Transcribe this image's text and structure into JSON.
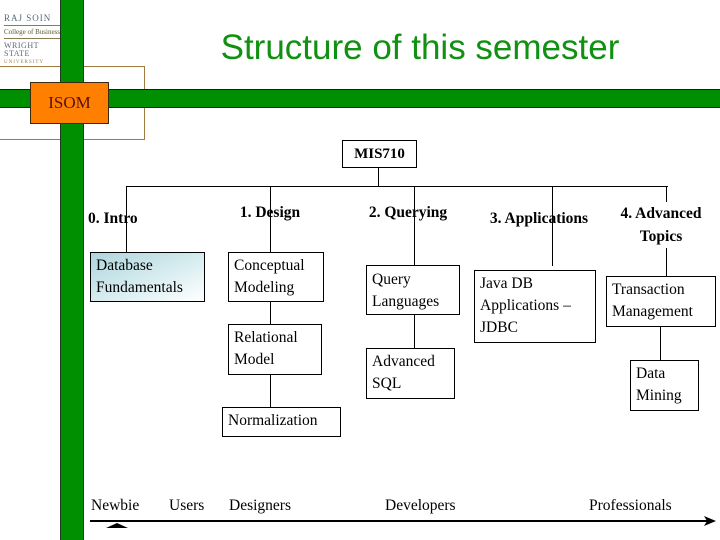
{
  "slide": {
    "title": "Structure of this semester",
    "badge": "ISOM",
    "logo": {
      "line1": "RAJ SOIN",
      "line2": "College of Business",
      "line3": "WRIGHT STATE",
      "line4": "UNIVERSITY"
    },
    "colors": {
      "title": "#119111",
      "green_bar": "#008f00",
      "badge_fill": "#ff7f00",
      "highlight_box": "#aed5dc"
    }
  },
  "tree": {
    "root": "MIS710",
    "categories": [
      {
        "label": "0. Intro",
        "children": [
          "Database Fundamentals"
        ]
      },
      {
        "label": "1. Design",
        "children": [
          "Conceptual Modeling",
          "Relational Model",
          "Normalization"
        ]
      },
      {
        "label": "2. Querying",
        "children": [
          "Query Languages",
          "Advanced SQL"
        ]
      },
      {
        "label": "3. Applications",
        "children": [
          "Java DB Applications – JDBC"
        ]
      },
      {
        "label": "4. Advanced Topics",
        "children": [
          "Transaction Management",
          "Data Mining"
        ]
      }
    ],
    "node_text": {
      "database_fundamentals": [
        "Database",
        "Fundamentals"
      ],
      "conceptual_modeling": [
        "Conceptual",
        "Modeling"
      ],
      "relational_model": [
        "Relational",
        "Model"
      ],
      "normalization": [
        "Normalization"
      ],
      "query_languages": [
        "Query",
        "Languages"
      ],
      "advanced_sql": [
        "Advanced",
        "SQL"
      ],
      "java_db": [
        "Java DB",
        "Applications –",
        "JDBC"
      ],
      "transaction_management": [
        "Transaction",
        "Management"
      ],
      "data_mining": [
        "Data",
        "Mining"
      ]
    },
    "category_text": {
      "intro": "0. Intro",
      "design": "1. Design",
      "querying": "2. Querying",
      "applications": "3. Applications",
      "advanced_1": "4. Advanced",
      "advanced_2": "Topics"
    }
  },
  "timeline": {
    "levels": [
      "Newbie",
      "Users",
      "Designers",
      "Developers",
      "Professionals"
    ],
    "current_level": "Newbie"
  }
}
